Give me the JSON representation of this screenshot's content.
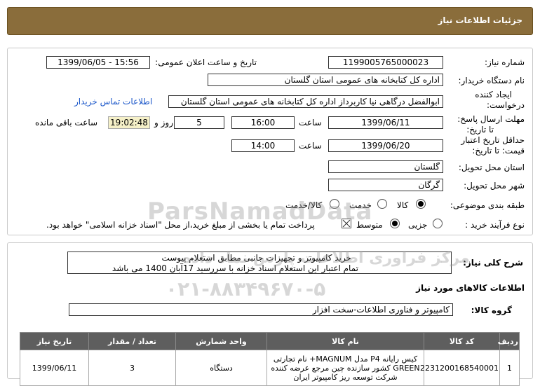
{
  "page_title": "جزئیات اطلاعات نیاز",
  "fields": {
    "need_number_label": "شماره نیاز:",
    "need_number": "1199005765000023",
    "announce_label": "تاریخ و ساعت اعلان عمومی:",
    "announce_value": "1399/06/05 - 15:56",
    "buyer_org_label": "نام دستگاه خریدار:",
    "buyer_org": "اداره کل کتابخانه های عمومی استان گلستان",
    "creator_label_1": "ایجاد کننده",
    "creator_label_2": "درخواست:",
    "creator": "ابوالفضل  درگاهی نیا کاربرداز اداره کل کتابخانه های عمومی استان گلستان",
    "contact_link": "اطلاعات تماس خریدار",
    "deadline_label_1": "مهلت ارسال پاسخ:",
    "deadline_label_2": "تا تاریخ:",
    "deadline_date": "1399/06/11",
    "time_label": "ساعت",
    "deadline_time": "16:00",
    "days_value": "5",
    "days_label": "روز و",
    "remaining_time": "19:02:48",
    "remaining_label": "ساعت باقی مانده",
    "validity_label_1": "حداقل تاریخ اعتبار",
    "validity_label_2": "قیمت: تا تاریخ:",
    "validity_date": "1399/06/20",
    "validity_time": "14:00",
    "province_label": "استان محل تحویل:",
    "province": "گلستان",
    "city_label": "شهر محل تحویل:",
    "city": "گرگان",
    "category_label": "طبقه بندی موضوعی:",
    "category_options": [
      "کالا",
      "خدمت",
      "کالا/خدمت"
    ],
    "purchase_type_label": "نوع فرآیند خرید :",
    "purchase_options": [
      "جزیی",
      "متوسط"
    ],
    "payment_note": "پرداخت تمام یا بخشی از مبلغ خرید،از محل \"اسناد خزانه اسلامی\" خواهد بود."
  },
  "description": {
    "label": "شرح کلی نیاز:",
    "line1": "خرید کامپیوتر و تجهیزات جانبی مطابق استعلام پیوست",
    "line2": "تمام اعتبار این استعلام اسناد خزانه با سررسید 17آبان 1400 می باشد"
  },
  "goods_section_title": "اطلاعات کالاهای مورد نیاز",
  "goods_group_label": "گروه کالا:",
  "goods_group": "کامپیوتر و فناوری اطلاعات-سخت افزار",
  "table": {
    "headers": [
      "ردیف",
      "کد کالا",
      "نام کالا",
      "واحد شمارش",
      "تعداد / مقدار",
      "تاریخ نیاز"
    ],
    "rows": [
      {
        "row": "1",
        "code": "2231200168540001",
        "name": "کیس رایانه P4 مدل MAGNUM+ نام تجارتی GREEN کشور سازنده چین مرجع عرضه کننده شرکت توسعه ریز کامپیوتر ایران",
        "unit": "دستگاه",
        "qty": "3",
        "date": "1399/06/11"
      }
    ]
  },
  "watermark": {
    "brand": "ParsNamadData",
    "tagline": "مرکز فراوری اطلاعات پارس نماد داده",
    "phone": "۰۲۱-۸۸۳۴۹۶۷۰-۵"
  }
}
